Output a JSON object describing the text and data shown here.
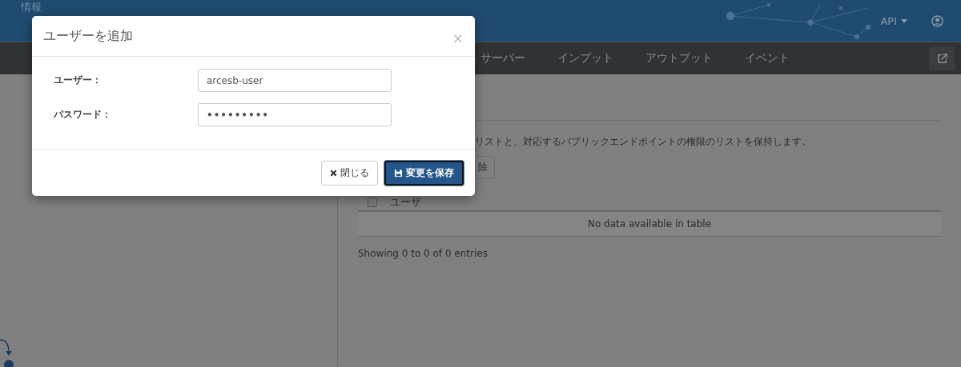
{
  "header": {
    "title": "情報",
    "api_menu": "API"
  },
  "nav": {
    "items": [
      "サーバー",
      "インプット",
      "アウトプット",
      "イベント"
    ]
  },
  "content": {
    "description": "リストと、対応するパブリックエンドポイントの権限のリストを保持します。",
    "button_fragment": "除",
    "table": {
      "select_all_checked": false,
      "columns": [
        "ユーザ"
      ],
      "empty_message": "No data available in table"
    },
    "info": "Showing 0 to 0 of 0 entries"
  },
  "dialog": {
    "title": "ユーザーを追加",
    "close": "×",
    "fields": [
      {
        "label": "ユーザー：",
        "value": "arcesb-user",
        "kind": "text"
      },
      {
        "label": "パスワード：",
        "value": "•••••••••",
        "kind": "password"
      }
    ],
    "buttons": [
      {
        "label": "閉じる",
        "kind": "default"
      },
      {
        "label": "変更を保存",
        "kind": "primary"
      }
    ]
  }
}
